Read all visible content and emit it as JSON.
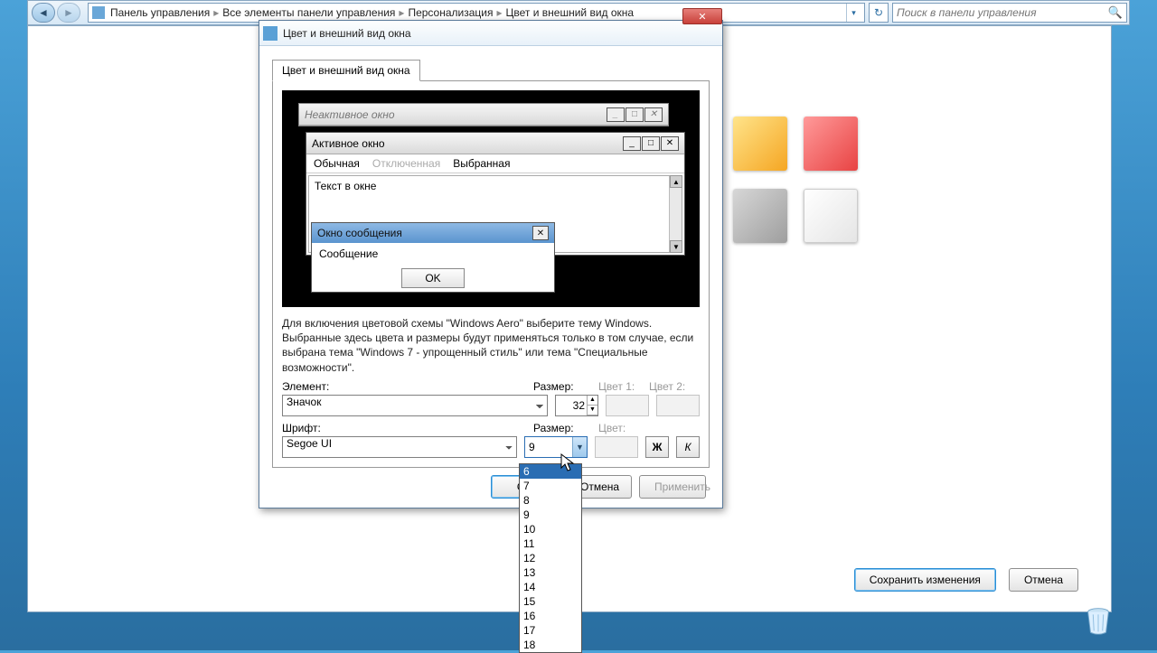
{
  "nav": {
    "path": [
      "Панель управления",
      "Все элементы панели управления",
      "Персонализация",
      "Цвет и внешний вид окна"
    ],
    "search_placeholder": "Поиск в панели управления"
  },
  "content": {
    "save_btn": "Сохранить изменения",
    "cancel_btn": "Отмена"
  },
  "dialog": {
    "title": "Цвет и внешний вид окна",
    "tab": "Цвет и внешний вид окна",
    "preview": {
      "inactive_title": "Неактивное окно",
      "active_title": "Активное окно",
      "menu_normal": "Обычная",
      "menu_disabled": "Отключенная",
      "menu_selected": "Выбранная",
      "text_in_window": "Текст в окне",
      "msgbox_title": "Окно сообщения",
      "msgbox_text": "Сообщение",
      "msgbox_ok": "OK"
    },
    "hint": "Для включения цветовой схемы \"Windows Aero\" выберите тему Windows. Выбранные здесь цвета и размеры будут применяться только в том случае, если выбрана тема \"Windows 7 - упрощенный стиль\" или тема \"Специальные возможности\".",
    "labels": {
      "element": "Элемент:",
      "size": "Размер:",
      "color1": "Цвет 1:",
      "color2": "Цвет 2:",
      "font": "Шрифт:",
      "size2": "Размер:",
      "color": "Цвет:"
    },
    "values": {
      "element": "Значок",
      "size": "32",
      "font": "Segoe UI",
      "font_size": "9"
    },
    "bold": "Ж",
    "italic": "К",
    "font_sizes": [
      "6",
      "7",
      "8",
      "9",
      "10",
      "11",
      "12",
      "13",
      "14",
      "15",
      "16",
      "17",
      "18"
    ],
    "footer": {
      "ok": "ОК",
      "cancel": "Отмена",
      "apply": "Применить"
    }
  }
}
